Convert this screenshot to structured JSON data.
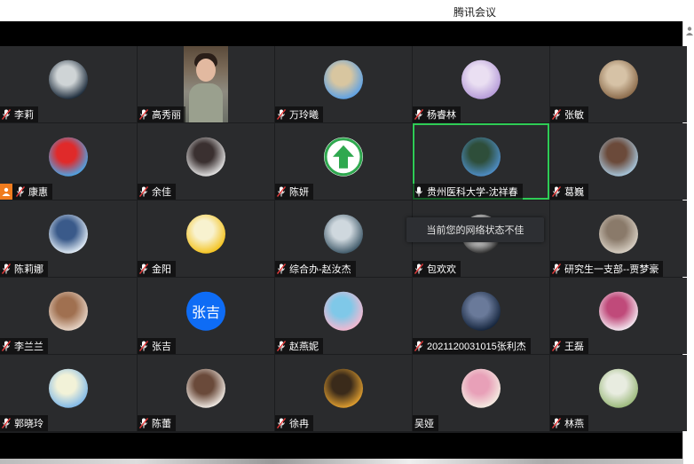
{
  "window": {
    "title": "腾讯会议"
  },
  "network_tooltip": "当前您的网络状态不佳",
  "participants": [
    {
      "name": "李莉",
      "avatar": "photo",
      "colors": [
        "#1b2a3a",
        "#cfd4d6"
      ]
    },
    {
      "name": "高秀丽",
      "avatar": "video"
    },
    {
      "name": "万玲曦",
      "avatar": "photo",
      "colors": [
        "#5aa0e6",
        "#d8c6a0"
      ]
    },
    {
      "name": "杨睿林",
      "avatar": "photo",
      "colors": [
        "#b59ad8",
        "#eadff2"
      ]
    },
    {
      "name": "张敏",
      "avatar": "photo",
      "colors": [
        "#8a6a4a",
        "#d6c2a6"
      ]
    },
    {
      "name": "康惠",
      "avatar": "photo",
      "host": true,
      "colors": [
        "#4aa6e8",
        "#e02a2a"
      ]
    },
    {
      "name": "余佳",
      "avatar": "photo",
      "colors": [
        "#e6e6e6",
        "#3a3030"
      ]
    },
    {
      "name": "陈妍",
      "avatar": "arrow",
      "colors": [
        "#2fa84f",
        "#ffffff"
      ]
    },
    {
      "name": "贵州医科大学-沈祥春",
      "avatar": "photo",
      "active": true,
      "colors": [
        "#4f8fc9",
        "#2e4e3a"
      ]
    },
    {
      "name": "葛巍",
      "avatar": "photo",
      "colors": [
        "#a8c8de",
        "#6b4a3a"
      ]
    },
    {
      "name": "陈莉娜",
      "avatar": "photo",
      "colors": [
        "#e4eef7",
        "#3a5a8a"
      ]
    },
    {
      "name": "金阳",
      "avatar": "photo",
      "colors": [
        "#f4c21c",
        "#f8f2cf"
      ]
    },
    {
      "name": "综合办-赵汝杰",
      "avatar": "photo",
      "colors": [
        "#3e5868",
        "#cfd8de"
      ]
    },
    {
      "name": "包欢欢",
      "avatar": "photo",
      "colors": [
        "#2a2a2a",
        "#ffffff"
      ]
    },
    {
      "name": "研究生一支部--贾梦豪",
      "avatar": "photo",
      "colors": [
        "#d8d0c4",
        "#8a7a6a"
      ]
    },
    {
      "name": "李兰兰",
      "avatar": "photo",
      "colors": [
        "#e8d6c8",
        "#a07050"
      ]
    },
    {
      "name": "张吉",
      "avatar": "text",
      "text": "张吉"
    },
    {
      "name": "赵燕妮",
      "avatar": "photo",
      "colors": [
        "#f6b8d0",
        "#7fc8e8"
      ]
    },
    {
      "name": "2021120031015张利杰",
      "avatar": "photo",
      "colors": [
        "#14243c",
        "#6a7a9a"
      ]
    },
    {
      "name": "王磊",
      "avatar": "photo",
      "colors": [
        "#f4eaf2",
        "#c04a7a"
      ]
    },
    {
      "name": "郭晓玲",
      "avatar": "photo",
      "colors": [
        "#7fb8e8",
        "#f2f2d8"
      ]
    },
    {
      "name": "陈蕾",
      "avatar": "photo",
      "colors": [
        "#f2ece6",
        "#6a4a3a"
      ]
    },
    {
      "name": "徐冉",
      "avatar": "photo",
      "colors": [
        "#e2a030",
        "#3a2a1a"
      ]
    },
    {
      "name": "吴娅",
      "avatar": "photo",
      "nomic": true,
      "colors": [
        "#f4ece2",
        "#e8a0b8"
      ]
    },
    {
      "name": "林燕",
      "avatar": "photo",
      "colors": [
        "#9ab87a",
        "#e8ece0"
      ]
    }
  ]
}
